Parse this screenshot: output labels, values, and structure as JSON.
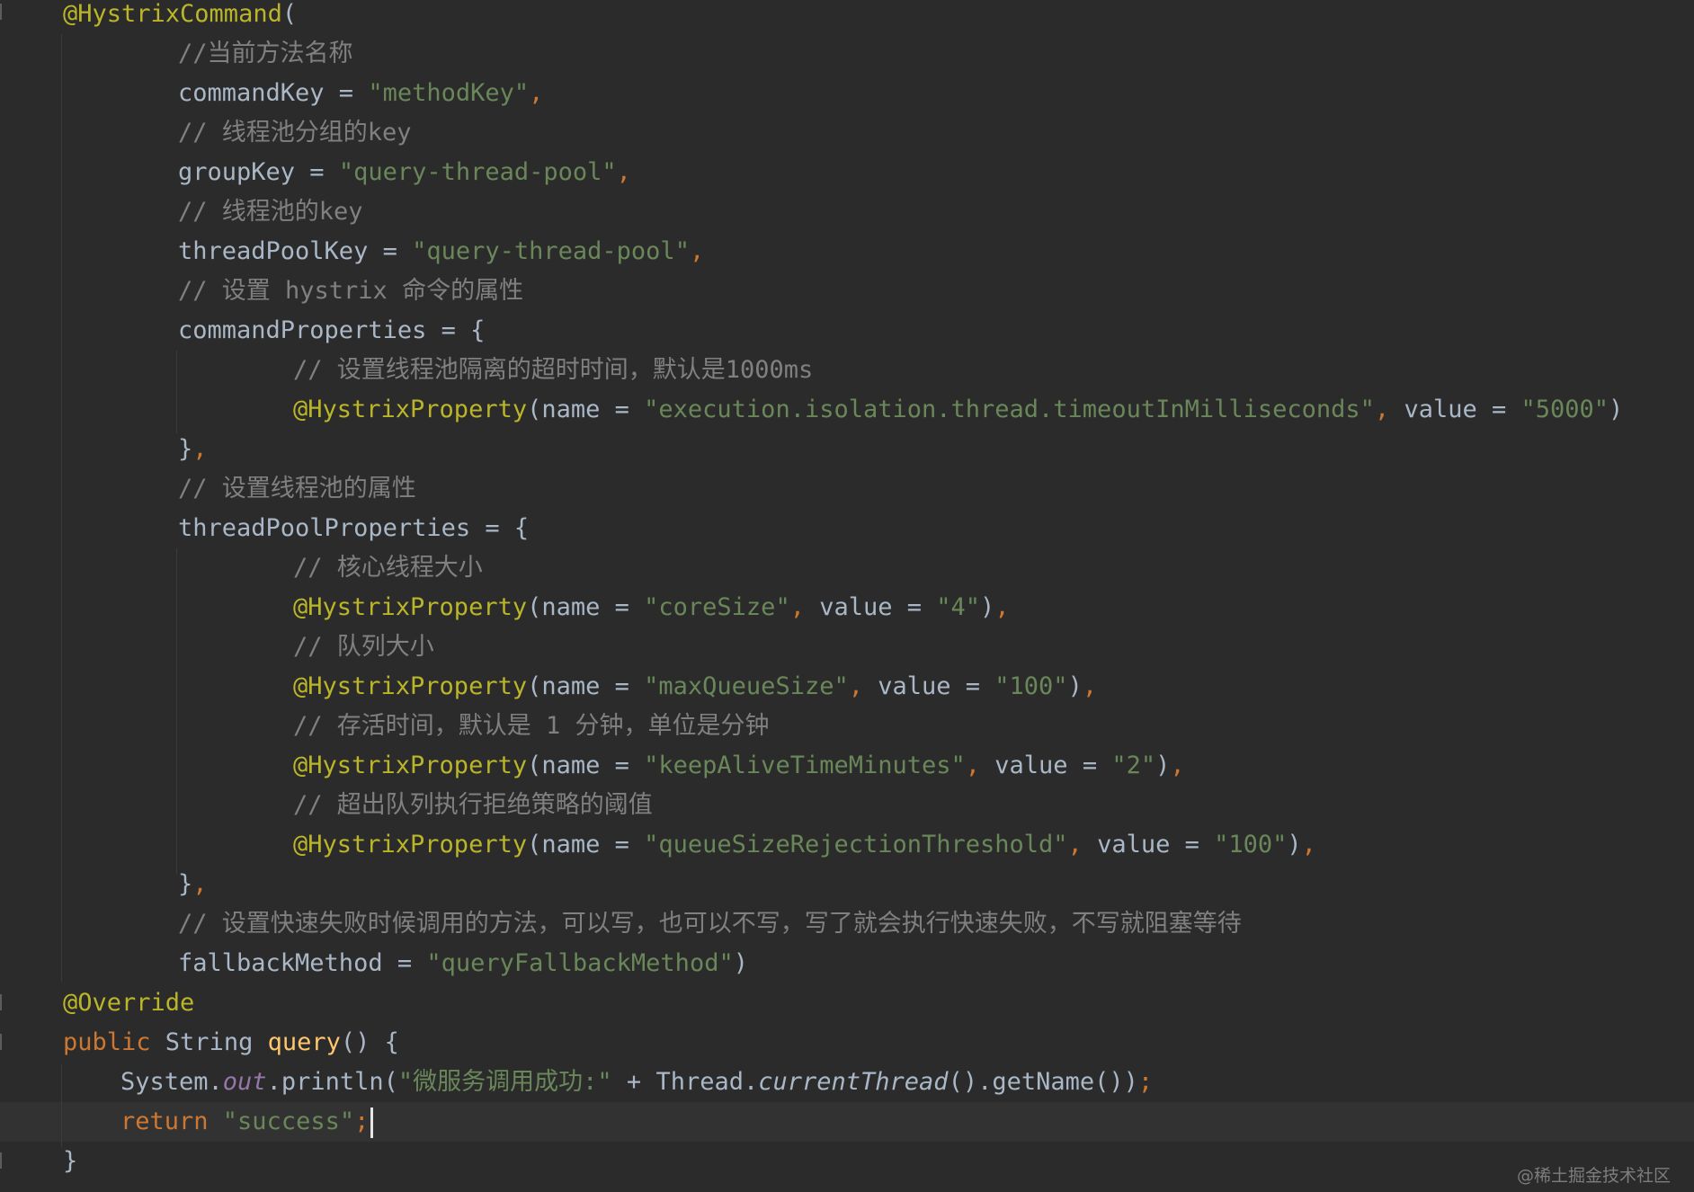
{
  "editor": {
    "theme": "darcula",
    "background": "#2b2b2b",
    "colors": {
      "annotation": "#bbb529",
      "keyword": "#cc7832",
      "string": "#6a8759",
      "comment": "#808080",
      "plain": "#a9b7c6",
      "field": "#9876aa",
      "method_decl": "#ffc66d"
    }
  },
  "code": {
    "l1_ann": "@HystrixCommand",
    "l1_paren": "(",
    "l2_comment": "//当前方法名称",
    "l3_key": "commandKey = ",
    "l3_val": "\"methodKey\"",
    "l3_comma": ",",
    "l4_comment": "// 线程池分组的key",
    "l5_key": "groupKey = ",
    "l5_val": "\"query-thread-pool\"",
    "l5_comma": ",",
    "l6_comment": "// 线程池的key",
    "l7_key": "threadPoolKey = ",
    "l7_val": "\"query-thread-pool\"",
    "l7_comma": ",",
    "l8_comment": "// 设置 hystrix 命令的属性",
    "l9_key": "commandProperties = {",
    "l10_comment": "// 设置线程池隔离的超时时间，默认是1000ms",
    "l11_ann": "@HystrixProperty",
    "l11_p1": "(name = ",
    "l11_name": "\"execution.isolation.thread.timeoutInMilliseconds\"",
    "l11_sep": ", ",
    "l11_p2": "value = ",
    "l11_value": "\"5000\"",
    "l11_close": ")",
    "l12_close": "}",
    "l12_comma": ",",
    "l13_comment": "// 设置线程池的属性",
    "l14_key": "threadPoolProperties = {",
    "l15_comment": "// 核心线程大小",
    "l16_ann": "@HystrixProperty",
    "l16_p1": "(name = ",
    "l16_name": "\"coreSize\"",
    "l16_sep": ", ",
    "l16_p2": "value = ",
    "l16_value": "\"4\"",
    "l16_close": ")",
    "l16_comma": ",",
    "l17_comment": "// 队列大小",
    "l18_ann": "@HystrixProperty",
    "l18_p1": "(name = ",
    "l18_name": "\"maxQueueSize\"",
    "l18_sep": ", ",
    "l18_p2": "value = ",
    "l18_value": "\"100\"",
    "l18_close": ")",
    "l18_comma": ",",
    "l19_comment": "// 存活时间，默认是 1 分钟，单位是分钟",
    "l20_ann": "@HystrixProperty",
    "l20_p1": "(name = ",
    "l20_name": "\"keepAliveTimeMinutes\"",
    "l20_sep": ", ",
    "l20_p2": "value = ",
    "l20_value": "\"2\"",
    "l20_close": ")",
    "l20_comma": ",",
    "l21_comment": "// 超出队列执行拒绝策略的阈值",
    "l22_ann": "@HystrixProperty",
    "l22_p1": "(name = ",
    "l22_name": "\"queueSizeRejectionThreshold\"",
    "l22_sep": ", ",
    "l22_p2": "value = ",
    "l22_value": "\"100\"",
    "l22_close": ")",
    "l22_comma": ",",
    "l23_close": "}",
    "l23_comma": ",",
    "l24_comment": "// 设置快速失败时候调用的方法，可以写，也可以不写，写了就会执行快速失败，不写就阻塞等待",
    "l25_key": "fallbackMethod = ",
    "l25_val": "\"queryFallbackMethod\"",
    "l25_close": ")",
    "l26_ann": "@Override",
    "l27_kw": "public ",
    "l27_type": "String ",
    "l27_method": "query",
    "l27_rest": "() {",
    "l28_sys": "System.",
    "l28_out": "out",
    "l28_println": ".println(",
    "l28_str": "\"微服务调用成功:\"",
    "l28_plus": " + Thread.",
    "l28_current": "currentThread",
    "l28_getname": "().getName())",
    "l28_semi": ";",
    "l29_kw": "return ",
    "l29_str": "\"success\"",
    "l29_semi": ";",
    "l30_close": "}"
  },
  "watermark": "@稀土掘金技术社区"
}
